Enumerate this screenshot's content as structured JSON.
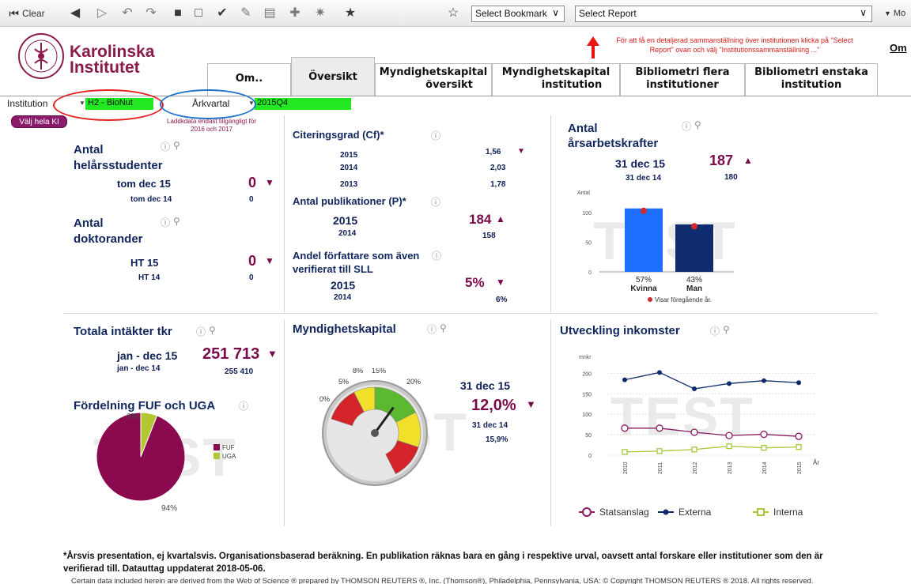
{
  "toolbar": {
    "clear_label": "Clear",
    "bookmark_select": "Select Bookmark",
    "report_select": "Select Report",
    "more_label": "Mo"
  },
  "header": {
    "logo_line1": "Karolinska",
    "logo_line2": "Institutet",
    "notice": "För att få en detaljerad sammanställning över institutionen klicka på \"Select Report\" ovan och välj \"Institutionssammanställning ...\"",
    "om_link": "Om",
    "tabs": [
      {
        "line1": "Om..",
        "line2": ""
      },
      {
        "line1": "Översikt",
        "line2": ""
      },
      {
        "line1": "Myndighetskapital",
        "line2": "översikt"
      },
      {
        "line1": "Myndighetskapital",
        "line2": "institution"
      },
      {
        "line1": "Bibliometri flera",
        "line2": "institutioner"
      },
      {
        "line1": "Bibliometri enstaka",
        "line2": "institution"
      }
    ]
  },
  "filters": {
    "institution_label": "Institution",
    "institution_value": "H2 - BioNut",
    "period_label": "Årkvartal",
    "period_value": "2015Q4",
    "select_all_ki": "Välj hela KI",
    "load_note_line1": "Laddkdata endast tillgängligt för",
    "load_note_line2": "2016 och 2017"
  },
  "students": {
    "title_line1": "Antal",
    "title_line2": "helårsstudenter",
    "current_label": "tom dec 15",
    "current_value": "0",
    "previous_label": "tom dec 14",
    "previous_value": "0"
  },
  "doctoral": {
    "title_line1": "Antal",
    "title_line2": "doktorander",
    "current_label": "HT 15",
    "current_value": "0",
    "previous_label": "HT 14",
    "previous_value": "0"
  },
  "citation": {
    "title": "Citeringsgrad (Cf)*",
    "rows": [
      {
        "year": "2015",
        "value": "1,56"
      },
      {
        "year": "2014",
        "value": "2,03"
      },
      {
        "year": "2013",
        "value": "1,78"
      }
    ]
  },
  "publications": {
    "title": "Antal publikationer (P)*",
    "current_label": "2015",
    "current_value": "184",
    "previous_label": "2014",
    "previous_value": "158"
  },
  "authors": {
    "title_line1": "Andel författare som även",
    "title_line2": "verifierat till SLL",
    "current_label": "2015",
    "current_value": "5%",
    "previous_label": "2014",
    "previous_value": "6%"
  },
  "staff": {
    "title_line1": "Antal",
    "title_line2": "årsarbetskrafter",
    "current_label": "31 dec 15",
    "current_value": "187",
    "previous_label": "31 dec 14",
    "previous_value": "180",
    "watermark": "TEST",
    "legend_note": "Visar föregående år."
  },
  "revenue": {
    "title": "Totala intäkter tkr",
    "current_label": "jan - dec 15",
    "current_value": "251 713",
    "previous_label": "jan - dec 14",
    "previous_value": "255 410"
  },
  "fuf": {
    "title": "Fördelning FUF och UGA",
    "watermark": "TEST"
  },
  "capital": {
    "title": "Myndighetskapital",
    "current_label": "31 dec 15",
    "current_value": "12,0%",
    "previous_label": "31 dec 14",
    "previous_value": "15,9%",
    "watermark": "TEST"
  },
  "income": {
    "title": "Utveckling inkomster",
    "watermark": "TEST"
  },
  "footer": {
    "note_line1": "*Årsvis presentation, ej kvartalsvis. Organisationsbaserad beräkning. En publikation räknas bara en gång i respektive urval, oavsett antal forskare eller institutioner som den är",
    "note_line2": "verifierad till. Datauttag uppdaterat 2018-05-06.",
    "copyright": "Certain data included herein are derived from the Web of Science ® prepared by THOMSON REUTERS ®, Inc. (Thomson®), Philadelphia, Pennsylvania, USA: © Copyright THOMSON REUTERS ® 2018. All rights reserved."
  },
  "chart_data": [
    {
      "type": "bar",
      "ylabel": "Antal",
      "ylim": [
        0,
        120
      ],
      "yticks": [
        "0",
        "50",
        "100"
      ],
      "categories": [
        "Kvinna",
        "Man"
      ],
      "category_percent": [
        "57%",
        "43%"
      ],
      "values": [
        107,
        80
      ],
      "previous_values": [
        103,
        77
      ],
      "colors": [
        "#1e6fff",
        "#0f2d6e",
        "#d02a2a"
      ]
    },
    {
      "type": "pie",
      "labels": [
        "FUF",
        "UGA"
      ],
      "values": [
        94,
        6
      ],
      "slice_labels": [
        "94%",
        "6%"
      ],
      "colors": [
        "#8b0a4f",
        "#b3c733"
      ]
    },
    {
      "type": "gauge",
      "value": 12.0,
      "tick_labels": [
        "0%",
        "5%",
        "8%",
        "15%",
        "20%"
      ],
      "colors": [
        "#d4242a",
        "#f0e02a",
        "#5cb82f"
      ]
    },
    {
      "type": "line",
      "ylabel": "mnkr",
      "xlabel": "År",
      "ylim": [
        0,
        220
      ],
      "yticks": [
        "0",
        "50",
        "100",
        "150",
        "200"
      ],
      "x": [
        "2010",
        "2011",
        "2012",
        "2013",
        "2014",
        "2015"
      ],
      "series": [
        {
          "name": "Statsanslag",
          "values": [
            66,
            66,
            56,
            48,
            51,
            46
          ],
          "color": "#8b1a63"
        },
        {
          "name": "Externa",
          "values": [
            184,
            202,
            162,
            175,
            182,
            177
          ],
          "color": "#0e2a6a"
        },
        {
          "name": "Interna",
          "values": [
            8,
            10,
            14,
            22,
            18,
            20
          ],
          "color": "#a5c83a"
        }
      ]
    }
  ]
}
